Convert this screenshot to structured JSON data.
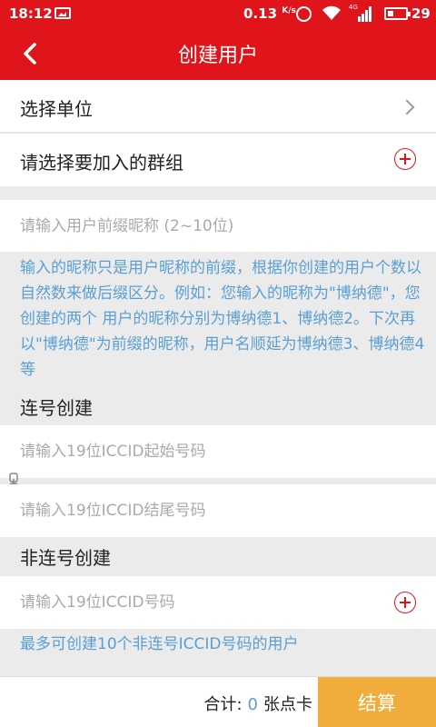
{
  "status_bar": {
    "time": "18:12",
    "speed_value": "0.13",
    "speed_unit": "K/s",
    "network": "4G",
    "battery": "29"
  },
  "header": {
    "title": "创建用户"
  },
  "form": {
    "select_unit_label": "选择单位",
    "select_group_label": "请选择要加入的群组",
    "prefix_input": {
      "value": "",
      "placeholder": "请输入用户前缀昵称 (2~10位)"
    },
    "prefix_hint": "输入的昵称只是用户昵称的前缀，根据你创建的用户个数以自然数来做后缀区分。例如：您输入的昵称为\"博纳德\"，您创建的两个 用户的昵称分别为博纳德1、博纳德2。下次再以\"博纳德\"为前缀的昵称，用户名顺延为博纳德3、博纳德4等",
    "consecutive_section": "连号创建",
    "start_iccid": {
      "value": "",
      "placeholder": "请输入19位ICCID起始号码"
    },
    "end_iccid": {
      "value": "",
      "placeholder": "请输入19位ICCID结尾号码"
    },
    "nonconsecutive_section": "非连号创建",
    "iccid_input": {
      "value": "",
      "placeholder": "请输入19位ICCID号码"
    },
    "nonconsecutive_hint": "最多可创建10个非连号ICCID号码的用户"
  },
  "footer": {
    "total_label": "合计:",
    "total_count": "0",
    "total_unit": "张点卡",
    "checkout_label": "结算"
  },
  "colors": {
    "brand_red": "#e0151b",
    "hint_blue": "#5a9fd4",
    "checkout_orange": "#f0ad3c"
  }
}
